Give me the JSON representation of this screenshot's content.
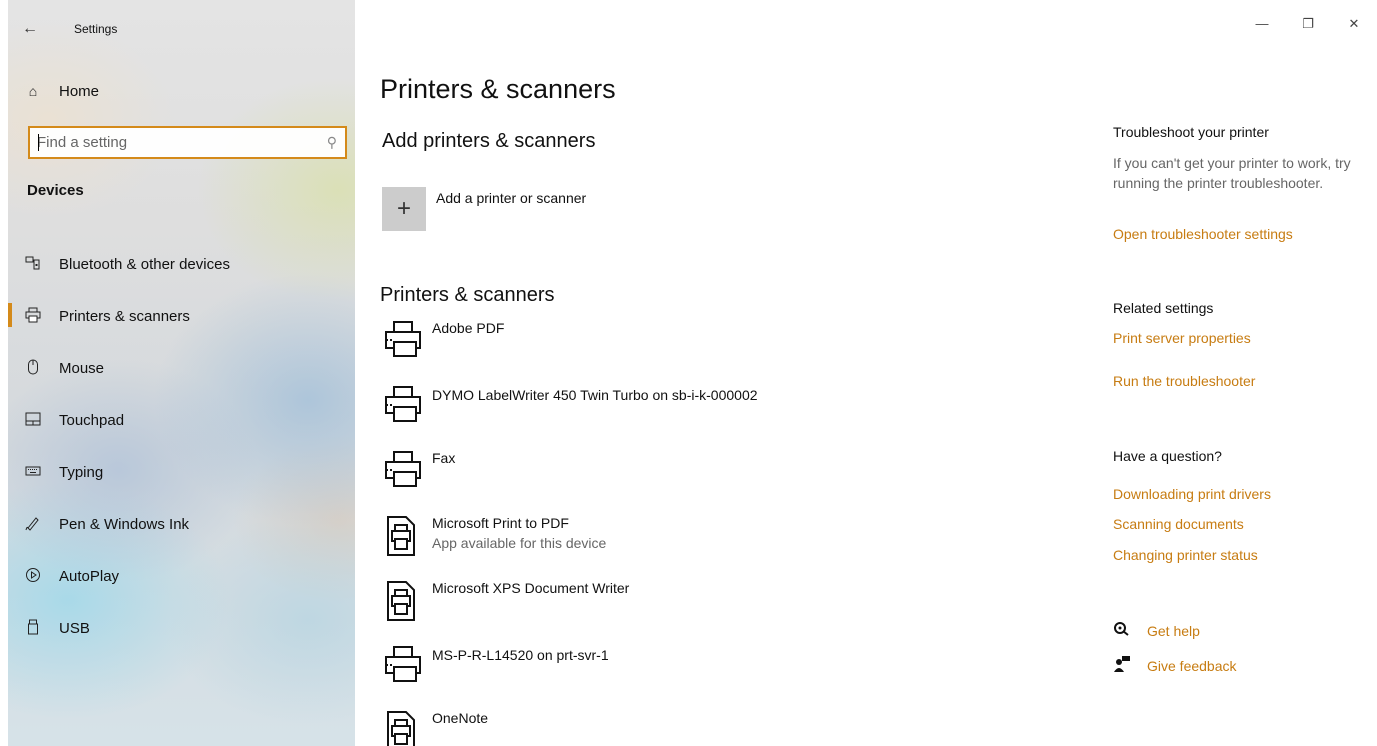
{
  "window": {
    "title": "Settings",
    "minimize_glyph": "—",
    "restore_glyph": "❐",
    "close_glyph": "✕"
  },
  "sidebar": {
    "home_label": "Home",
    "search_placeholder": "Find a setting",
    "section_title": "Devices",
    "items": [
      {
        "label": "Bluetooth & other devices",
        "icon": "bluetooth-devices-icon",
        "selected": false
      },
      {
        "label": "Printers & scanners",
        "icon": "printer-icon",
        "selected": true
      },
      {
        "label": "Mouse",
        "icon": "mouse-icon",
        "selected": false
      },
      {
        "label": "Touchpad",
        "icon": "touchpad-icon",
        "selected": false
      },
      {
        "label": "Typing",
        "icon": "keyboard-icon",
        "selected": false
      },
      {
        "label": "Pen & Windows Ink",
        "icon": "pen-icon",
        "selected": false
      },
      {
        "label": "AutoPlay",
        "icon": "autoplay-icon",
        "selected": false
      },
      {
        "label": "USB",
        "icon": "usb-icon",
        "selected": false
      }
    ]
  },
  "main": {
    "page_title": "Printers & scanners",
    "add_section_title": "Add printers & scanners",
    "add_label": "Add a printer or scanner",
    "list_title": "Printers & scanners",
    "printers": [
      {
        "name": "Adobe PDF",
        "sub": "",
        "icon": "printer-icon"
      },
      {
        "name": "DYMO LabelWriter 450 Twin Turbo on sb-i-k-000002",
        "sub": "",
        "icon": "printer-icon"
      },
      {
        "name": "Fax",
        "sub": "",
        "icon": "printer-icon"
      },
      {
        "name": "Microsoft Print to PDF",
        "sub": "App available for this device",
        "icon": "document-printer-icon"
      },
      {
        "name": "Microsoft XPS Document Writer",
        "sub": "",
        "icon": "document-printer-icon"
      },
      {
        "name": "MS-P-R-L14520 on prt-svr-1",
        "sub": "",
        "icon": "printer-icon"
      },
      {
        "name": "OneNote",
        "sub": "",
        "icon": "document-printer-icon"
      }
    ]
  },
  "rail": {
    "troubleshoot_title": "Troubleshoot your printer",
    "troubleshoot_text": "If you can't get your printer to work, try running the printer troubleshooter.",
    "troubleshoot_link": "Open troubleshooter settings",
    "related_title": "Related settings",
    "related_links": [
      "Print server properties",
      "Run the troubleshooter"
    ],
    "question_title": "Have a question?",
    "question_links": [
      "Downloading print drivers",
      "Scanning documents",
      "Changing printer status"
    ],
    "get_help": "Get help",
    "give_feedback": "Give feedback"
  },
  "colors": {
    "accent": "#d48a1a",
    "link": "#c77c12"
  }
}
